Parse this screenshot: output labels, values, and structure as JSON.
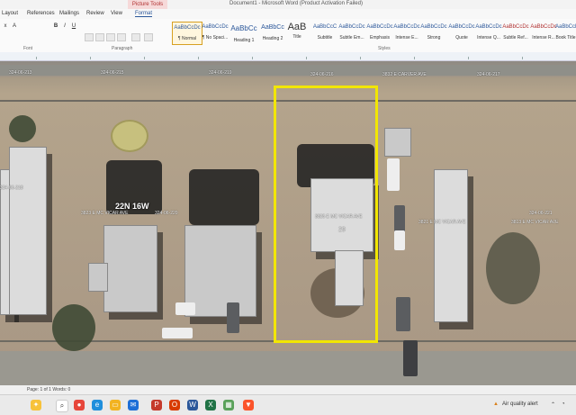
{
  "window": {
    "title": "Document1 - Microsoft Word (Product Activation Failed)",
    "context_tab": "Picture Tools"
  },
  "tabs": [
    {
      "label": "Layout"
    },
    {
      "label": "References"
    },
    {
      "label": "Mailings"
    },
    {
      "label": "Review"
    },
    {
      "label": "View"
    },
    {
      "label": "Format",
      "active": true
    }
  ],
  "ribbon": {
    "font_label": "Font",
    "paragraph_label": "Paragraph",
    "styles_label": "Styles",
    "format_buttons": [
      "x",
      "A",
      "B",
      "I",
      "U"
    ],
    "styles": [
      {
        "sample": "AaBbCcDc",
        "name": "¶ Normal",
        "selected": true
      },
      {
        "sample": "AaBbCcDc",
        "name": "¶ No Spaci..."
      },
      {
        "sample": "AaBbCc",
        "name": "Heading 1"
      },
      {
        "sample": "AaBbCc",
        "name": "Heading 2"
      },
      {
        "sample": "AaB",
        "name": "Title"
      },
      {
        "sample": "AaBbCcC",
        "name": "Subtitle"
      },
      {
        "sample": "AaBbCcDc",
        "name": "Subtle Em..."
      },
      {
        "sample": "AaBbCcDc",
        "name": "Emphasis"
      },
      {
        "sample": "AaBbCcDc",
        "name": "Intense E..."
      },
      {
        "sample": "AaBbCcDc",
        "name": "Strong"
      },
      {
        "sample": "AaBbCcDc",
        "name": "Quote"
      },
      {
        "sample": "AaBbCcDc",
        "name": "Intense Q..."
      },
      {
        "sample": "AaBbCcDc",
        "name": "Subtle Ref..."
      },
      {
        "sample": "AaBbCcDc",
        "name": "Intense R..."
      },
      {
        "sample": "AaBbCcDc",
        "name": "Book Title"
      }
    ]
  },
  "map": {
    "grid_label": "22N 16W",
    "lot_number": "29",
    "parcel_labels": [
      "324-06-213",
      "324-06-215",
      "324-06-219",
      "324-06-216",
      "324-06-217",
      "324-06-218",
      "324-06-220",
      "324-06-221",
      "3825 E MC VICAR AVE",
      "3823 E MC VICAR AVE",
      "3821 E MC VICAR AVE",
      "3813 E MC VICAR AVE",
      "3832 E CARVER AVE"
    ],
    "highlight_color": "#f2e600"
  },
  "statusbar": {
    "left_text": "Page: 1 of 1   Words: 0"
  },
  "taskbar": {
    "air_quality": "Air quality alert",
    "icons": [
      "search-icon",
      "widgets-icon",
      "chrome-icon",
      "edge-icon",
      "file-explorer-icon",
      "mail-icon",
      "word-icon",
      "excel-icon",
      "store-icon",
      "brave-icon"
    ]
  }
}
